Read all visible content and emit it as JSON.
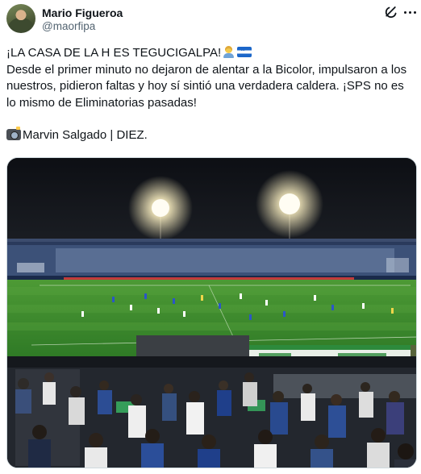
{
  "author": {
    "name": "Mario Figueroa",
    "handle": "@maorfipa",
    "avatar_icon": "profile-photo"
  },
  "actions": {
    "grok_icon": "grok-icon",
    "more_icon": "more-options-icon"
  },
  "tweet": {
    "line1": "¡LA CASA DE LA H ES TEGUCIGALPA!",
    "line2": "Desde el primer minuto no dejaron de alentar a la Bicolor, impulsaron a los nuestros, pidieron faltas y hoy sí sintió una verdadera caldera. ¡SPS no es lo mismo de Eliminatorias pasadas!",
    "credit": "Marvin Salgado | DIEZ.",
    "emoji_after_line1": [
      "person-emoji",
      "honduras-flag-emoji"
    ],
    "emoji_before_credit": "camera-flash-emoji"
  },
  "media": {
    "type": "photo",
    "subject": "stadium-night-crowd"
  },
  "colors": {
    "text": "#0f1419",
    "secondary": "#536471",
    "border": "#cfd9de",
    "pitch": "#3f8a2e",
    "floodlight": "#fff6d8"
  }
}
